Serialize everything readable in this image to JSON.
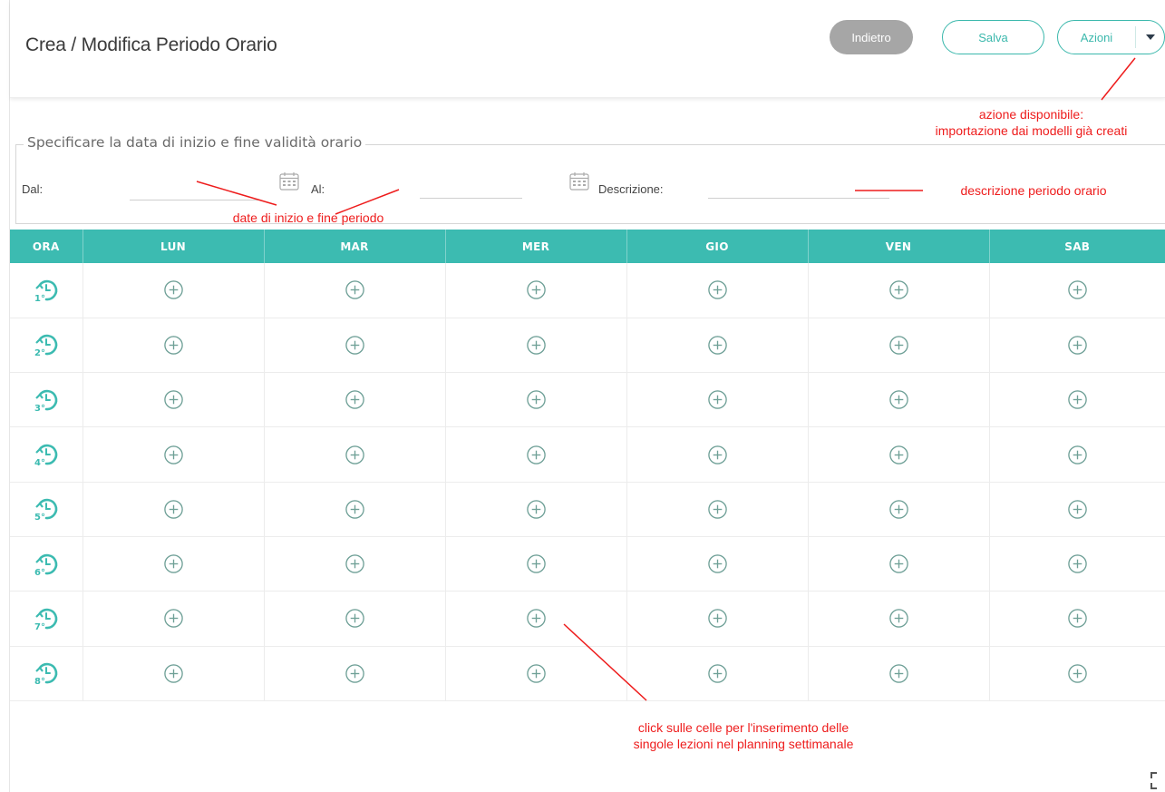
{
  "header": {
    "title": "Crea / Modifica Periodo Orario",
    "back_label": "Indietro",
    "save_label": "Salva",
    "actions_label": "Azioni"
  },
  "form": {
    "legend": "Specificare la data di inizio e fine validità orario",
    "from_label": "Dal:",
    "to_label": "Al:",
    "description_label": "Descrizione:",
    "from_value": "",
    "to_value": "",
    "description_value": ""
  },
  "table": {
    "columns": [
      "ORA",
      "LUN",
      "MAR",
      "MER",
      "GIO",
      "VEN",
      "SAB"
    ],
    "hours": [
      "1°",
      "2°",
      "3°",
      "4°",
      "5°",
      "6°",
      "7°",
      "8°"
    ]
  },
  "annotations": {
    "actions_line1": "azione disponibile:",
    "actions_line2": "importazione dai modelli già creati",
    "dates": "date di inizio e fine periodo",
    "description": "descrizione periodo orario",
    "cells_line1": "click sulle celle per l'inserimento delle",
    "cells_line2": "singole lezioni nel planning settimanale"
  },
  "colors": {
    "accent": "#3cbbb1",
    "annotation": "#ee1c1c",
    "back_button": "#a6a6a6"
  },
  "icons": {
    "add_cell": "plus-circle-icon",
    "hour": "clock-hour-icon",
    "calendar": "calendar-icon",
    "dropdown": "caret-down-icon",
    "fullscreen": "expand-icon"
  }
}
